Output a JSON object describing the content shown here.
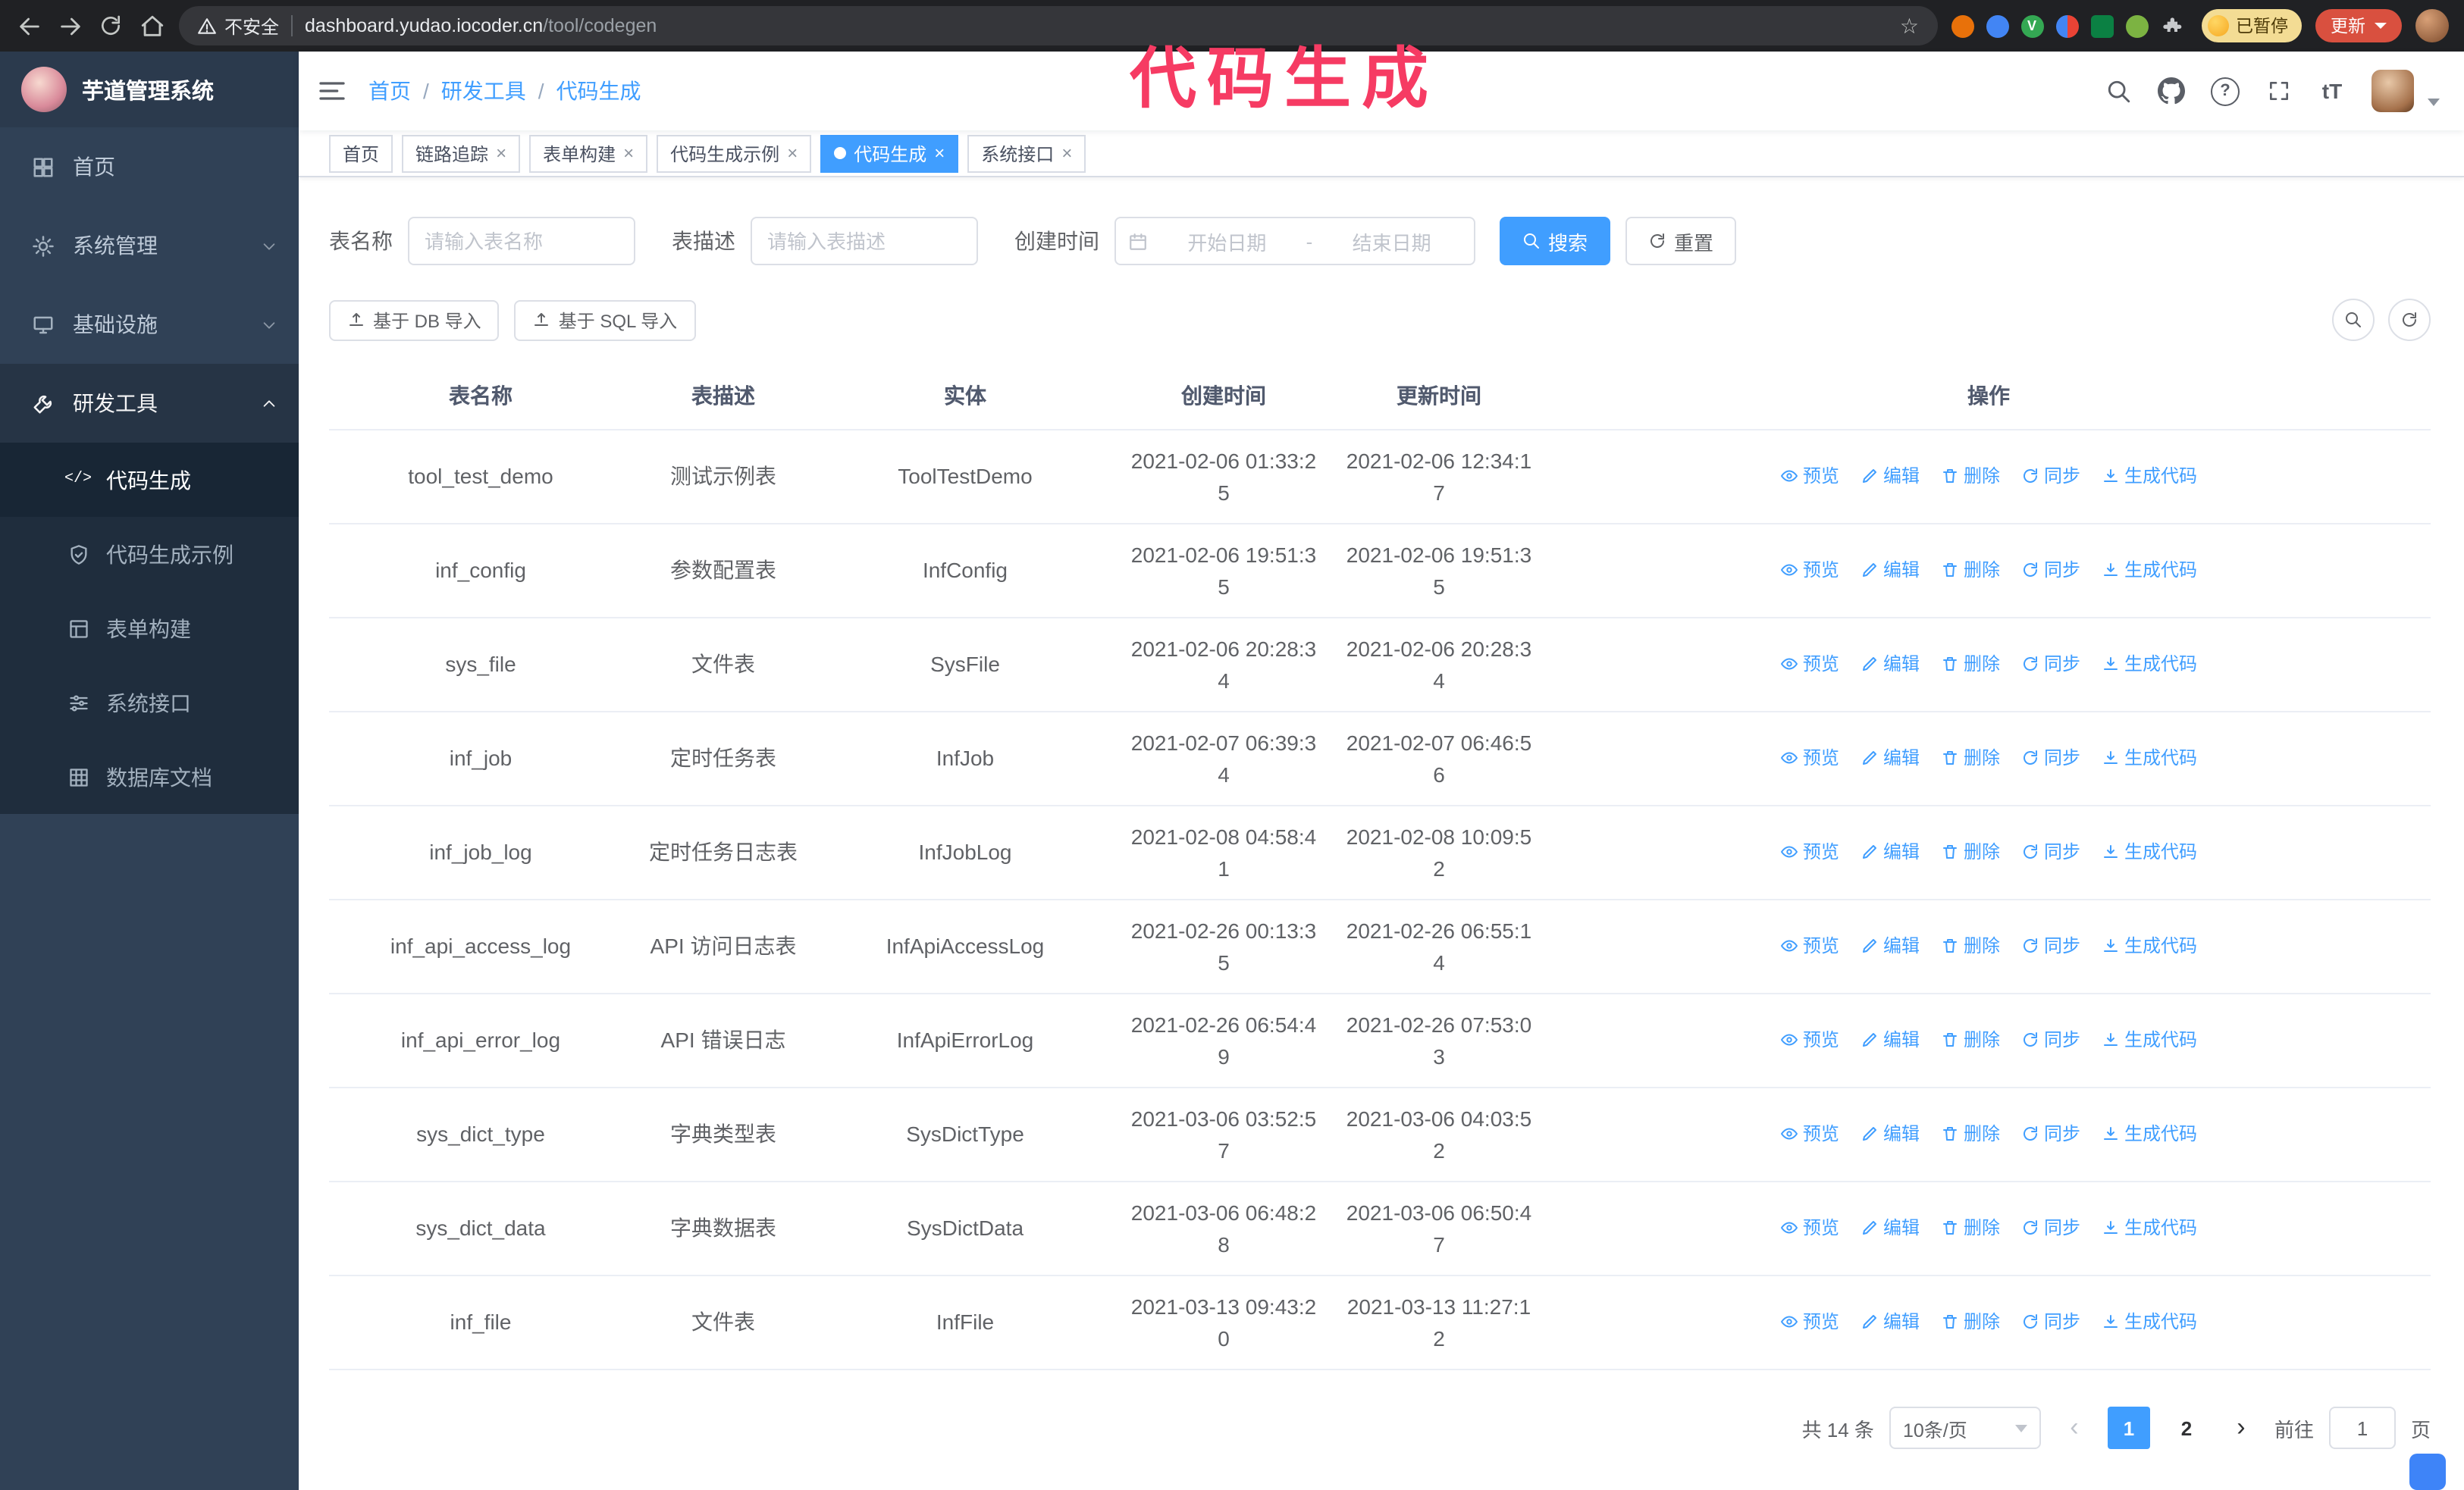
{
  "browser": {
    "security_label": "不安全",
    "url_host": "dashboard.yudao.iocoder.cn",
    "url_path": "/tool/codegen",
    "paused_badge": "已暂停",
    "update_button": "更新",
    "icons": [
      "back-icon",
      "forward-icon",
      "refresh-icon",
      "home-icon",
      "warning-icon",
      "star-icon",
      "extensions",
      "profile-avatar"
    ]
  },
  "annotation": {
    "text": "代码生成",
    "color": "#f63b63"
  },
  "sidebar": {
    "logo_title": "芋道管理系统",
    "items": [
      {
        "label": "首页",
        "icon": "home-icon"
      },
      {
        "label": "系统管理",
        "icon": "gear-icon",
        "expandable": true
      },
      {
        "label": "基础设施",
        "icon": "infrastructure-icon",
        "expandable": true
      },
      {
        "label": "研发工具",
        "icon": "tools-icon",
        "expandable": true,
        "expanded": true
      }
    ],
    "sub_items": [
      {
        "label": "代码生成",
        "icon": "code-icon",
        "active": true
      },
      {
        "label": "代码生成示例",
        "icon": "example-icon"
      },
      {
        "label": "表单构建",
        "icon": "form-icon"
      },
      {
        "label": "系统接口",
        "icon": "api-icon"
      },
      {
        "label": "数据库文档",
        "icon": "database-icon"
      }
    ]
  },
  "header": {
    "breadcrumb": [
      "首页",
      "研发工具",
      "代码生成"
    ],
    "separator": "/",
    "font_size_icon_text": "tT",
    "icons": [
      "search-icon",
      "github-icon",
      "help-icon",
      "fullscreen-icon",
      "font-size-icon",
      "user-avatar"
    ]
  },
  "tabs": [
    {
      "label": "首页",
      "closable": false,
      "active": false
    },
    {
      "label": "链路追踪",
      "closable": true,
      "active": false
    },
    {
      "label": "表单构建",
      "closable": true,
      "active": false
    },
    {
      "label": "代码生成示例",
      "closable": true,
      "active": false
    },
    {
      "label": "代码生成",
      "closable": true,
      "active": true
    },
    {
      "label": "系统接口",
      "closable": true,
      "active": false
    }
  ],
  "filters": {
    "table_name_label": "表名称",
    "table_name_placeholder": "请输入表名称",
    "table_desc_label": "表描述",
    "table_desc_placeholder": "请输入表描述",
    "create_time_label": "创建时间",
    "date_start_placeholder": "开始日期",
    "date_separator": "-",
    "date_end_placeholder": "结束日期",
    "search_button": "搜索",
    "reset_button": "重置"
  },
  "toolbar": {
    "import_db_button": "基于 DB 导入",
    "import_sql_button": "基于 SQL 导入",
    "icons": [
      "zoom-toggle-icon",
      "refresh-icon"
    ]
  },
  "table": {
    "columns": [
      "表名称",
      "表描述",
      "实体",
      "创建时间",
      "更新时间",
      "操作"
    ],
    "actions": [
      "预览",
      "编辑",
      "删除",
      "同步",
      "生成代码"
    ],
    "action_icons": [
      "eye-icon",
      "pencil-icon",
      "trash-icon",
      "sync-icon",
      "download-icon"
    ],
    "rows": [
      {
        "name": "tool_test_demo",
        "desc": "测试示例表",
        "entity": "ToolTestDemo",
        "created": "2021-02-06 01:33:25",
        "updated": "2021-02-06 12:34:17"
      },
      {
        "name": "inf_config",
        "desc": "参数配置表",
        "entity": "InfConfig",
        "created": "2021-02-06 19:51:35",
        "updated": "2021-02-06 19:51:35"
      },
      {
        "name": "sys_file",
        "desc": "文件表",
        "entity": "SysFile",
        "created": "2021-02-06 20:28:34",
        "updated": "2021-02-06 20:28:34"
      },
      {
        "name": "inf_job",
        "desc": "定时任务表",
        "entity": "InfJob",
        "created": "2021-02-07 06:39:34",
        "updated": "2021-02-07 06:46:56"
      },
      {
        "name": "inf_job_log",
        "desc": "定时任务日志表",
        "entity": "InfJobLog",
        "created": "2021-02-08 04:58:41",
        "updated": "2021-02-08 10:09:52"
      },
      {
        "name": "inf_api_access_log",
        "desc": "API 访问日志表",
        "entity": "InfApiAccessLog",
        "created": "2021-02-26 00:13:35",
        "updated": "2021-02-26 06:55:14"
      },
      {
        "name": "inf_api_error_log",
        "desc": "API 错误日志",
        "entity": "InfApiErrorLog",
        "created": "2021-02-26 06:54:49",
        "updated": "2021-02-26 07:53:03"
      },
      {
        "name": "sys_dict_type",
        "desc": "字典类型表",
        "entity": "SysDictType",
        "created": "2021-03-06 03:52:57",
        "updated": "2021-03-06 04:03:52"
      },
      {
        "name": "sys_dict_data",
        "desc": "字典数据表",
        "entity": "SysDictData",
        "created": "2021-03-06 06:48:28",
        "updated": "2021-03-06 06:50:47"
      },
      {
        "name": "inf_file",
        "desc": "文件表",
        "entity": "InfFile",
        "created": "2021-03-13 09:43:20",
        "updated": "2021-03-13 11:27:12"
      }
    ]
  },
  "pagination": {
    "total_label": "共 14 条",
    "page_size_label": "10条/页",
    "pages": [
      "1",
      "2"
    ],
    "active_page": "1",
    "goto_label": "前往",
    "goto_value": "1",
    "goto_unit": "页"
  }
}
